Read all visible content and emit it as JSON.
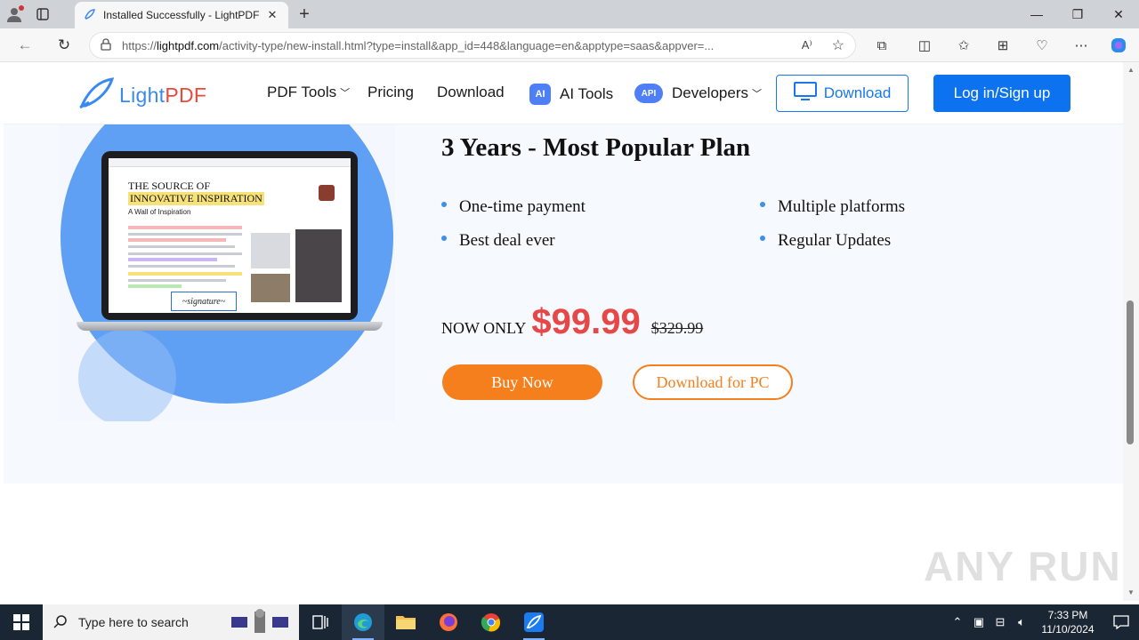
{
  "browser": {
    "tab_title": "Installed Successfully - LightPDF",
    "url_prefix": "https://",
    "url_domain": "lightpdf.com",
    "url_rest": "/activity-type/new-install.html?type=install&app_id=448&language=en&apptype=saas&appver=..."
  },
  "header": {
    "logo_light": "Light",
    "logo_pdf": "PDF",
    "nav_pdf_tools": "PDF Tools",
    "nav_pricing": "Pricing",
    "nav_download": "Download",
    "ai_badge": "AI",
    "nav_ai_tools": "AI Tools",
    "api_badge": "API",
    "nav_developers": "Developers",
    "download_button": "Download",
    "login_button": "Log in/Sign up"
  },
  "laptop_doc": {
    "title_line1": "THE SOURCE OF",
    "title_line2": "INNOVATIVE INSPIRATION",
    "subtitle": "A Wall of Inspiration"
  },
  "plan": {
    "title": "3 Years - Most Popular Plan",
    "features": [
      "One-time payment",
      "Multiple platforms",
      "Best deal ever",
      "Regular Updates"
    ],
    "now_only": "NOW ONLY",
    "price": "$99.99",
    "old_price": "$329.99",
    "buy_button": "Buy Now",
    "pc_button": "Download for PC"
  },
  "watermark": "ANY RUN",
  "taskbar": {
    "search_placeholder": "Type here to search",
    "time": "7:33 PM",
    "date": "11/10/2024"
  },
  "colors": {
    "brand_blue": "#0d72f0",
    "price_red": "#e64848",
    "orange": "#f57f1d"
  }
}
